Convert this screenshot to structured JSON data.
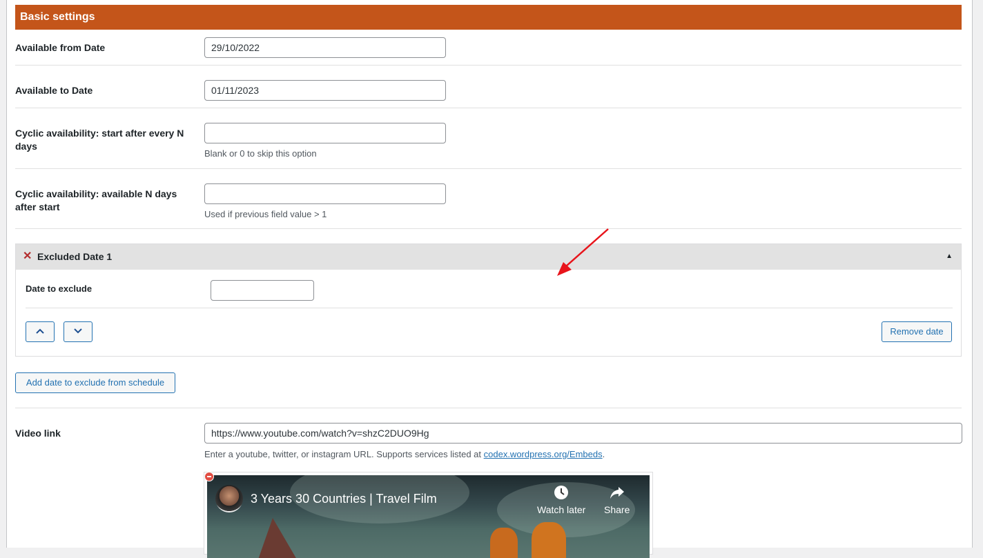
{
  "section": {
    "title": "Basic settings",
    "header_color": "#c4551a"
  },
  "fields": {
    "available_from": {
      "label": "Available from Date",
      "value": "29/10/2022"
    },
    "available_to": {
      "label": "Available to Date",
      "value": "01/11/2023"
    },
    "cyclic_start": {
      "label": "Cyclic availability: start after every N days",
      "value": "",
      "description": "Blank or 0 to skip this option"
    },
    "cyclic_available": {
      "label": "Cyclic availability: available N days after start",
      "value": "",
      "description": "Used if previous field value > 1"
    }
  },
  "excluded_group": {
    "title": "Excluded Date 1",
    "remove_icon": "close-icon",
    "toggle_icon": "triangle-up-icon",
    "toggle_glyph": "▲",
    "remove_glyph": "✕",
    "date_label": "Date to exclude",
    "date_value": "",
    "move_up_icon": "chevron-up-icon",
    "move_down_icon": "chevron-down-icon",
    "remove_button": "Remove date"
  },
  "add_excluded_button": "Add date to exclude from schedule",
  "video": {
    "label": "Video link",
    "value": "https://www.youtube.com/watch?v=shzC2DUO9Hg",
    "description_prefix": "Enter a youtube, twitter, or instagram URL. Supports services listed at ",
    "description_link": "codex.wordpress.org/Embeds",
    "description_suffix": ".",
    "embed": {
      "title": "3 Years 30 Countries | Travel Film",
      "watch_later": "Watch later",
      "share": "Share"
    }
  },
  "annotation": {
    "arrow_color": "#e8141b"
  }
}
